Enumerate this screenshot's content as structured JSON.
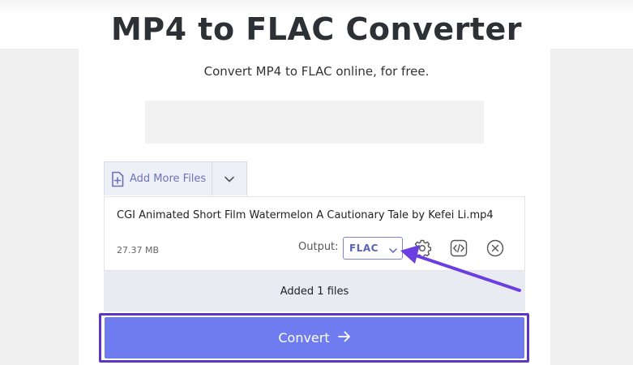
{
  "page": {
    "title": "MP4 to FLAC Converter",
    "subtitle": "Convert MP4 to FLAC online, for free."
  },
  "uploader": {
    "add_more_label": "Add More Files",
    "add_more_icon": "file-plus-icon",
    "dropdown_icon": "chevron-down-icon"
  },
  "file": {
    "name": "CGI Animated Short Film Watermelon A Cautionary Tale by Kefei Li.mp4",
    "size": "27.37 MB",
    "output_label": "Output:",
    "output_format": "FLAC",
    "icons": [
      "gear-icon",
      "code-icon",
      "close-circle-icon"
    ]
  },
  "status": {
    "added_text": "Added 1 files"
  },
  "actions": {
    "convert_label": "Convert",
    "convert_icon": "arrow-right-icon"
  },
  "colors": {
    "accent": "#6e7cf0",
    "highlight_outline": "#5a35c8",
    "annotation_arrow": "#6a3ee0",
    "link_text": "#6b73b8"
  }
}
